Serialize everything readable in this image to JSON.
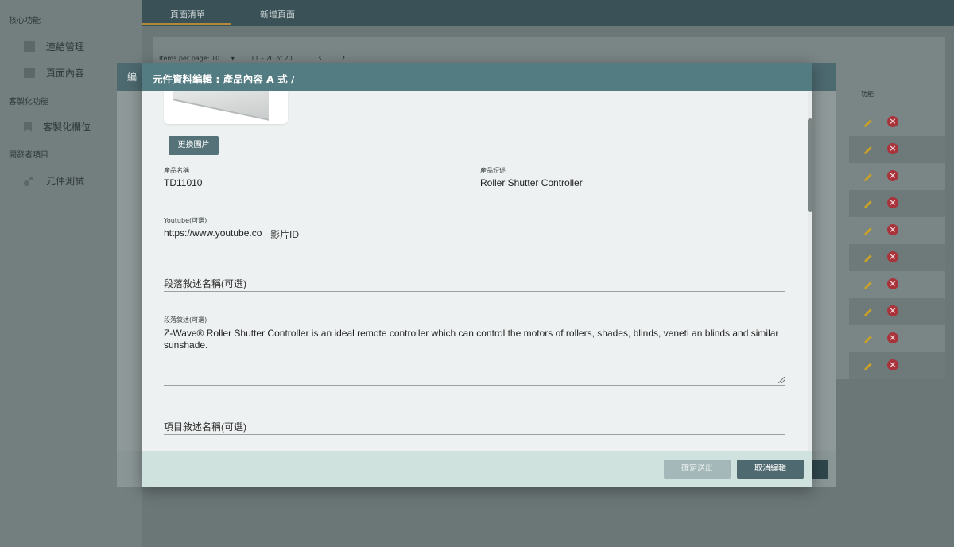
{
  "sidebar": {
    "sections": [
      {
        "title": "核心功能",
        "items": [
          {
            "label": "連結管理",
            "icon": "link-management-icon"
          },
          {
            "label": "頁面內容",
            "icon": "page-content-icon"
          }
        ]
      },
      {
        "title": "客製化功能",
        "items": [
          {
            "label": "客製化欄位",
            "icon": "bookmark-icon"
          }
        ]
      },
      {
        "title": "開發者項目",
        "items": [
          {
            "label": "元件測試",
            "icon": "component-test-icon"
          }
        ]
      }
    ]
  },
  "topbar": {
    "tabs": [
      {
        "label": "頁面清單",
        "active": true
      },
      {
        "label": "新增頁面",
        "active": false
      }
    ],
    "accent_color": "#b3893a"
  },
  "list": {
    "items_per_page_label": "Items per page:",
    "items_per_page_value": "10",
    "range": "11 – 20 of 20",
    "column_header": "功能"
  },
  "under_dialog": {
    "title": "編"
  },
  "modal": {
    "title": "元件資料編輯 : 產品內容 A 式 /",
    "change_image_button": "更換圖片",
    "product_name": {
      "label": "產品名稱",
      "value": "TD11010"
    },
    "product_short": {
      "label": "產品短述",
      "value": "Roller Shutter Controller"
    },
    "youtube": {
      "label": "Youtube(可選)",
      "prefix": "https://www.youtube.co",
      "placeholder": "影片ID"
    },
    "paragraph_title": {
      "placeholder": "段落敘述名稱(可選)"
    },
    "paragraph": {
      "label": "段落敘述(可選)",
      "value": "Z-Wave® Roller Shutter Controller is an ideal remote controller which can control the motors of rollers, shades, blinds, veneti an blinds and similar sunshade."
    },
    "item_title": {
      "placeholder": "項目敘述名稱(可選)"
    },
    "submit_button": "確定送出",
    "cancel_button": "取消編輯"
  },
  "colors": {
    "modal_header": "#537b82",
    "delete": "#a8333a",
    "edit": "#c9a227"
  }
}
